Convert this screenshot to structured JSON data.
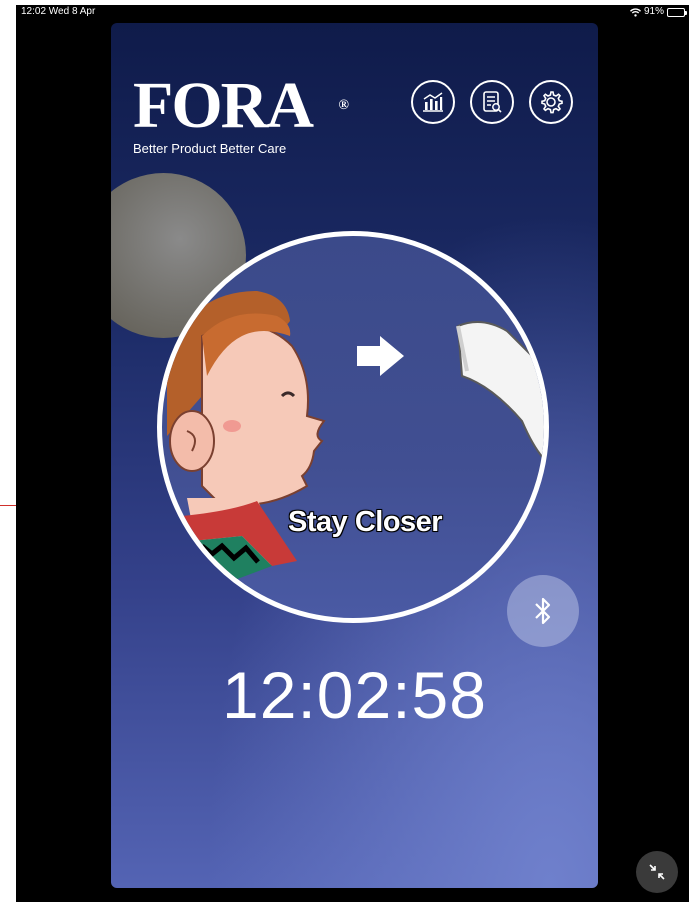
{
  "status_bar": {
    "time_date": "12:02  Wed 8 Apr",
    "battery_percent": "91%",
    "battery_level": 0.91
  },
  "brand": {
    "logo_text": "FORA",
    "registered_mark": "®",
    "tagline": "Better Product Better Care"
  },
  "toolbar": {
    "icons": [
      "chart-icon",
      "record-search-icon",
      "settings-gear-icon"
    ]
  },
  "measurement": {
    "instruction": "Stay Closer"
  },
  "clock": {
    "time": "12:02:58"
  },
  "colors": {
    "accent_red": "#d0302c",
    "battery_green": "#47d147",
    "bg_top": "#0f1b4a",
    "bg_bottom": "#5464b4"
  }
}
